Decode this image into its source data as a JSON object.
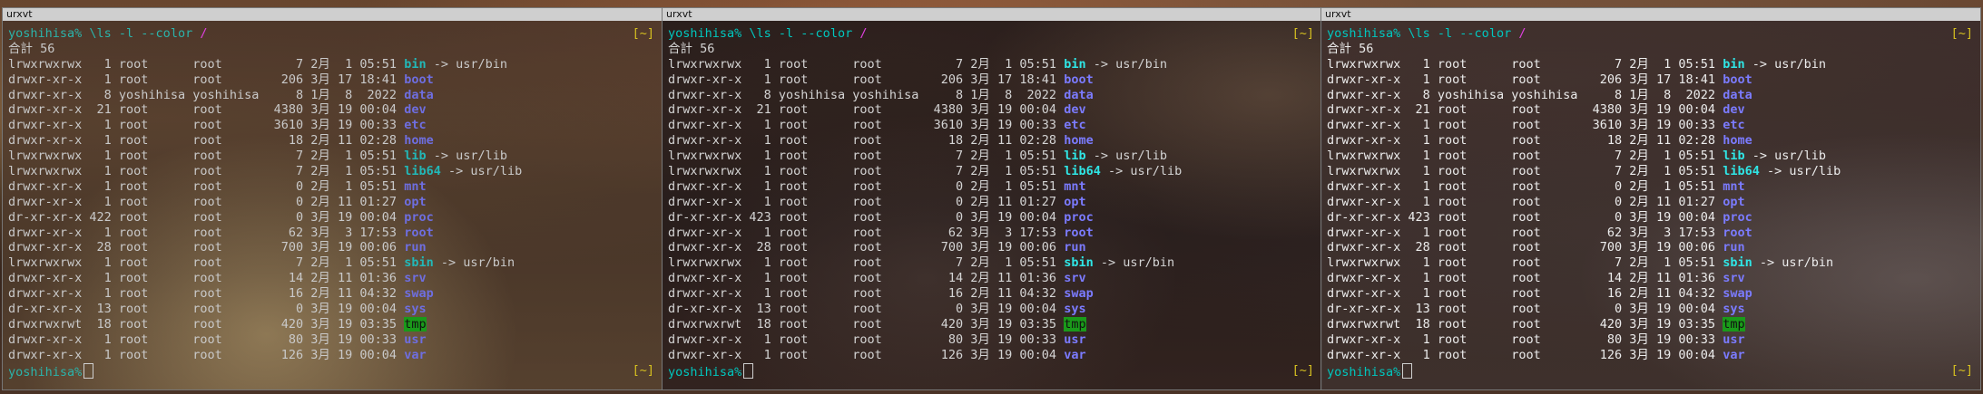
{
  "windows": [
    {
      "title": "urxvt",
      "prompt": {
        "user_host": "yoshihisa%",
        "command": " \\ls -l --color ",
        "cwd_glyph": "/",
        "cwd_tag": "[~]"
      },
      "total": "合計 56",
      "rows": [
        {
          "perm": "lrwxrwxrwx",
          "links": "1",
          "owner": "root",
          "group": "root",
          "size": "7",
          "month": "2月",
          "day": "1",
          "time": "05:51",
          "name": "bin",
          "kind": "link",
          "target": "usr/bin"
        },
        {
          "perm": "drwxr-xr-x",
          "links": "1",
          "owner": "root",
          "group": "root",
          "size": "206",
          "month": "3月",
          "day": "17",
          "time": "18:41",
          "name": "boot",
          "kind": "dir",
          "target": ""
        },
        {
          "perm": "drwxr-xr-x",
          "links": "8",
          "owner": "yoshihisa",
          "group": "yoshihisa",
          "size": "8",
          "month": "1月",
          "day": "8",
          "time": "2022",
          "name": "data",
          "kind": "dir",
          "target": ""
        },
        {
          "perm": "drwxr-xr-x",
          "links": "21",
          "owner": "root",
          "group": "root",
          "size": "4380",
          "month": "3月",
          "day": "19",
          "time": "00:04",
          "name": "dev",
          "kind": "dir",
          "target": ""
        },
        {
          "perm": "drwxr-xr-x",
          "links": "1",
          "owner": "root",
          "group": "root",
          "size": "3610",
          "month": "3月",
          "day": "19",
          "time": "00:33",
          "name": "etc",
          "kind": "dir",
          "target": ""
        },
        {
          "perm": "drwxr-xr-x",
          "links": "1",
          "owner": "root",
          "group": "root",
          "size": "18",
          "month": "2月",
          "day": "11",
          "time": "02:28",
          "name": "home",
          "kind": "dir",
          "target": ""
        },
        {
          "perm": "lrwxrwxrwx",
          "links": "1",
          "owner": "root",
          "group": "root",
          "size": "7",
          "month": "2月",
          "day": "1",
          "time": "05:51",
          "name": "lib",
          "kind": "link",
          "target": "usr/lib"
        },
        {
          "perm": "lrwxrwxrwx",
          "links": "1",
          "owner": "root",
          "group": "root",
          "size": "7",
          "month": "2月",
          "day": "1",
          "time": "05:51",
          "name": "lib64",
          "kind": "link",
          "target": "usr/lib"
        },
        {
          "perm": "drwxr-xr-x",
          "links": "1",
          "owner": "root",
          "group": "root",
          "size": "0",
          "month": "2月",
          "day": "1",
          "time": "05:51",
          "name": "mnt",
          "kind": "dir",
          "target": ""
        },
        {
          "perm": "drwxr-xr-x",
          "links": "1",
          "owner": "root",
          "group": "root",
          "size": "0",
          "month": "2月",
          "day": "11",
          "time": "01:27",
          "name": "opt",
          "kind": "dir",
          "target": ""
        },
        {
          "perm": "dr-xr-xr-x",
          "links": "422",
          "owner": "root",
          "group": "root",
          "size": "0",
          "month": "3月",
          "day": "19",
          "time": "00:04",
          "name": "proc",
          "kind": "dir",
          "target": ""
        },
        {
          "perm": "drwxr-xr-x",
          "links": "1",
          "owner": "root",
          "group": "root",
          "size": "62",
          "month": "3月",
          "day": "3",
          "time": "17:53",
          "name": "root",
          "kind": "dir",
          "target": ""
        },
        {
          "perm": "drwxr-xr-x",
          "links": "28",
          "owner": "root",
          "group": "root",
          "size": "700",
          "month": "3月",
          "day": "19",
          "time": "00:06",
          "name": "run",
          "kind": "dir",
          "target": ""
        },
        {
          "perm": "lrwxrwxrwx",
          "links": "1",
          "owner": "root",
          "group": "root",
          "size": "7",
          "month": "2月",
          "day": "1",
          "time": "05:51",
          "name": "sbin",
          "kind": "link",
          "target": "usr/bin"
        },
        {
          "perm": "drwxr-xr-x",
          "links": "1",
          "owner": "root",
          "group": "root",
          "size": "14",
          "month": "2月",
          "day": "11",
          "time": "01:36",
          "name": "srv",
          "kind": "dir",
          "target": ""
        },
        {
          "perm": "drwxr-xr-x",
          "links": "1",
          "owner": "root",
          "group": "root",
          "size": "16",
          "month": "2月",
          "day": "11",
          "time": "04:32",
          "name": "swap",
          "kind": "dir",
          "target": ""
        },
        {
          "perm": "dr-xr-xr-x",
          "links": "13",
          "owner": "root",
          "group": "root",
          "size": "0",
          "month": "3月",
          "day": "19",
          "time": "00:04",
          "name": "sys",
          "kind": "dir",
          "target": ""
        },
        {
          "perm": "drwxrwxrwt",
          "links": "18",
          "owner": "root",
          "group": "root",
          "size": "420",
          "month": "3月",
          "day": "19",
          "time": "03:35",
          "name": "tmp",
          "kind": "sticky",
          "target": ""
        },
        {
          "perm": "drwxr-xr-x",
          "links": "1",
          "owner": "root",
          "group": "root",
          "size": "80",
          "month": "3月",
          "day": "19",
          "time": "00:33",
          "name": "usr",
          "kind": "dir",
          "target": ""
        },
        {
          "perm": "drwxr-xr-x",
          "links": "1",
          "owner": "root",
          "group": "root",
          "size": "126",
          "month": "3月",
          "day": "19",
          "time": "00:04",
          "name": "var",
          "kind": "dir",
          "target": ""
        }
      ],
      "end_prompt": "yoshihisa%",
      "end_cwd_tag": "[~]"
    },
    {
      "title": "urxvt",
      "prompt": {
        "user_host": "yoshihisa%",
        "command": " \\ls -l --color ",
        "cwd_glyph": "/",
        "cwd_tag": "[~]"
      },
      "total": "合計 56",
      "rows": [
        {
          "perm": "lrwxrwxrwx",
          "links": "1",
          "owner": "root",
          "group": "root",
          "size": "7",
          "month": "2月",
          "day": "1",
          "time": "05:51",
          "name": "bin",
          "kind": "link",
          "target": "usr/bin"
        },
        {
          "perm": "drwxr-xr-x",
          "links": "1",
          "owner": "root",
          "group": "root",
          "size": "206",
          "month": "3月",
          "day": "17",
          "time": "18:41",
          "name": "boot",
          "kind": "dir",
          "target": ""
        },
        {
          "perm": "drwxr-xr-x",
          "links": "8",
          "owner": "yoshihisa",
          "group": "yoshihisa",
          "size": "8",
          "month": "1月",
          "day": "8",
          "time": "2022",
          "name": "data",
          "kind": "dir",
          "target": ""
        },
        {
          "perm": "drwxr-xr-x",
          "links": "21",
          "owner": "root",
          "group": "root",
          "size": "4380",
          "month": "3月",
          "day": "19",
          "time": "00:04",
          "name": "dev",
          "kind": "dir",
          "target": ""
        },
        {
          "perm": "drwxr-xr-x",
          "links": "1",
          "owner": "root",
          "group": "root",
          "size": "3610",
          "month": "3月",
          "day": "19",
          "time": "00:33",
          "name": "etc",
          "kind": "dir",
          "target": ""
        },
        {
          "perm": "drwxr-xr-x",
          "links": "1",
          "owner": "root",
          "group": "root",
          "size": "18",
          "month": "2月",
          "day": "11",
          "time": "02:28",
          "name": "home",
          "kind": "dir",
          "target": ""
        },
        {
          "perm": "lrwxrwxrwx",
          "links": "1",
          "owner": "root",
          "group": "root",
          "size": "7",
          "month": "2月",
          "day": "1",
          "time": "05:51",
          "name": "lib",
          "kind": "link",
          "target": "usr/lib"
        },
        {
          "perm": "lrwxrwxrwx",
          "links": "1",
          "owner": "root",
          "group": "root",
          "size": "7",
          "month": "2月",
          "day": "1",
          "time": "05:51",
          "name": "lib64",
          "kind": "link",
          "target": "usr/lib"
        },
        {
          "perm": "drwxr-xr-x",
          "links": "1",
          "owner": "root",
          "group": "root",
          "size": "0",
          "month": "2月",
          "day": "1",
          "time": "05:51",
          "name": "mnt",
          "kind": "dir",
          "target": ""
        },
        {
          "perm": "drwxr-xr-x",
          "links": "1",
          "owner": "root",
          "group": "root",
          "size": "0",
          "month": "2月",
          "day": "11",
          "time": "01:27",
          "name": "opt",
          "kind": "dir",
          "target": ""
        },
        {
          "perm": "dr-xr-xr-x",
          "links": "423",
          "owner": "root",
          "group": "root",
          "size": "0",
          "month": "3月",
          "day": "19",
          "time": "00:04",
          "name": "proc",
          "kind": "dir",
          "target": ""
        },
        {
          "perm": "drwxr-xr-x",
          "links": "1",
          "owner": "root",
          "group": "root",
          "size": "62",
          "month": "3月",
          "day": "3",
          "time": "17:53",
          "name": "root",
          "kind": "dir",
          "target": ""
        },
        {
          "perm": "drwxr-xr-x",
          "links": "28",
          "owner": "root",
          "group": "root",
          "size": "700",
          "month": "3月",
          "day": "19",
          "time": "00:06",
          "name": "run",
          "kind": "dir",
          "target": ""
        },
        {
          "perm": "lrwxrwxrwx",
          "links": "1",
          "owner": "root",
          "group": "root",
          "size": "7",
          "month": "2月",
          "day": "1",
          "time": "05:51",
          "name": "sbin",
          "kind": "link",
          "target": "usr/bin"
        },
        {
          "perm": "drwxr-xr-x",
          "links": "1",
          "owner": "root",
          "group": "root",
          "size": "14",
          "month": "2月",
          "day": "11",
          "time": "01:36",
          "name": "srv",
          "kind": "dir",
          "target": ""
        },
        {
          "perm": "drwxr-xr-x",
          "links": "1",
          "owner": "root",
          "group": "root",
          "size": "16",
          "month": "2月",
          "day": "11",
          "time": "04:32",
          "name": "swap",
          "kind": "dir",
          "target": ""
        },
        {
          "perm": "dr-xr-xr-x",
          "links": "13",
          "owner": "root",
          "group": "root",
          "size": "0",
          "month": "3月",
          "day": "19",
          "time": "00:04",
          "name": "sys",
          "kind": "dir",
          "target": ""
        },
        {
          "perm": "drwxrwxrwt",
          "links": "18",
          "owner": "root",
          "group": "root",
          "size": "420",
          "month": "3月",
          "day": "19",
          "time": "03:35",
          "name": "tmp",
          "kind": "sticky",
          "target": ""
        },
        {
          "perm": "drwxr-xr-x",
          "links": "1",
          "owner": "root",
          "group": "root",
          "size": "80",
          "month": "3月",
          "day": "19",
          "time": "00:33",
          "name": "usr",
          "kind": "dir",
          "target": ""
        },
        {
          "perm": "drwxr-xr-x",
          "links": "1",
          "owner": "root",
          "group": "root",
          "size": "126",
          "month": "3月",
          "day": "19",
          "time": "00:04",
          "name": "var",
          "kind": "dir",
          "target": ""
        }
      ],
      "end_prompt": "yoshihisa%",
      "end_cwd_tag": "[~]"
    },
    {
      "title": "urxvt",
      "prompt": {
        "user_host": "yoshihisa%",
        "command": " \\ls -l --color ",
        "cwd_glyph": "/",
        "cwd_tag": "[~]"
      },
      "total": "合計 56",
      "rows": [
        {
          "perm": "lrwxrwxrwx",
          "links": "1",
          "owner": "root",
          "group": "root",
          "size": "7",
          "month": "2月",
          "day": "1",
          "time": "05:51",
          "name": "bin",
          "kind": "link",
          "target": "usr/bin"
        },
        {
          "perm": "drwxr-xr-x",
          "links": "1",
          "owner": "root",
          "group": "root",
          "size": "206",
          "month": "3月",
          "day": "17",
          "time": "18:41",
          "name": "boot",
          "kind": "dir",
          "target": ""
        },
        {
          "perm": "drwxr-xr-x",
          "links": "8",
          "owner": "yoshihisa",
          "group": "yoshihisa",
          "size": "8",
          "month": "1月",
          "day": "8",
          "time": "2022",
          "name": "data",
          "kind": "dir",
          "target": ""
        },
        {
          "perm": "drwxr-xr-x",
          "links": "21",
          "owner": "root",
          "group": "root",
          "size": "4380",
          "month": "3月",
          "day": "19",
          "time": "00:04",
          "name": "dev",
          "kind": "dir",
          "target": ""
        },
        {
          "perm": "drwxr-xr-x",
          "links": "1",
          "owner": "root",
          "group": "root",
          "size": "3610",
          "month": "3月",
          "day": "19",
          "time": "00:33",
          "name": "etc",
          "kind": "dir",
          "target": ""
        },
        {
          "perm": "drwxr-xr-x",
          "links": "1",
          "owner": "root",
          "group": "root",
          "size": "18",
          "month": "2月",
          "day": "11",
          "time": "02:28",
          "name": "home",
          "kind": "dir",
          "target": ""
        },
        {
          "perm": "lrwxrwxrwx",
          "links": "1",
          "owner": "root",
          "group": "root",
          "size": "7",
          "month": "2月",
          "day": "1",
          "time": "05:51",
          "name": "lib",
          "kind": "link",
          "target": "usr/lib"
        },
        {
          "perm": "lrwxrwxrwx",
          "links": "1",
          "owner": "root",
          "group": "root",
          "size": "7",
          "month": "2月",
          "day": "1",
          "time": "05:51",
          "name": "lib64",
          "kind": "link",
          "target": "usr/lib"
        },
        {
          "perm": "drwxr-xr-x",
          "links": "1",
          "owner": "root",
          "group": "root",
          "size": "0",
          "month": "2月",
          "day": "1",
          "time": "05:51",
          "name": "mnt",
          "kind": "dir",
          "target": ""
        },
        {
          "perm": "drwxr-xr-x",
          "links": "1",
          "owner": "root",
          "group": "root",
          "size": "0",
          "month": "2月",
          "day": "11",
          "time": "01:27",
          "name": "opt",
          "kind": "dir",
          "target": ""
        },
        {
          "perm": "dr-xr-xr-x",
          "links": "423",
          "owner": "root",
          "group": "root",
          "size": "0",
          "month": "3月",
          "day": "19",
          "time": "00:04",
          "name": "proc",
          "kind": "dir",
          "target": ""
        },
        {
          "perm": "drwxr-xr-x",
          "links": "1",
          "owner": "root",
          "group": "root",
          "size": "62",
          "month": "3月",
          "day": "3",
          "time": "17:53",
          "name": "root",
          "kind": "dir",
          "target": ""
        },
        {
          "perm": "drwxr-xr-x",
          "links": "28",
          "owner": "root",
          "group": "root",
          "size": "700",
          "month": "3月",
          "day": "19",
          "time": "00:06",
          "name": "run",
          "kind": "dir",
          "target": ""
        },
        {
          "perm": "lrwxrwxrwx",
          "links": "1",
          "owner": "root",
          "group": "root",
          "size": "7",
          "month": "2月",
          "day": "1",
          "time": "05:51",
          "name": "sbin",
          "kind": "link",
          "target": "usr/bin"
        },
        {
          "perm": "drwxr-xr-x",
          "links": "1",
          "owner": "root",
          "group": "root",
          "size": "14",
          "month": "2月",
          "day": "11",
          "time": "01:36",
          "name": "srv",
          "kind": "dir",
          "target": ""
        },
        {
          "perm": "drwxr-xr-x",
          "links": "1",
          "owner": "root",
          "group": "root",
          "size": "16",
          "month": "2月",
          "day": "11",
          "time": "04:32",
          "name": "swap",
          "kind": "dir",
          "target": ""
        },
        {
          "perm": "dr-xr-xr-x",
          "links": "13",
          "owner": "root",
          "group": "root",
          "size": "0",
          "month": "3月",
          "day": "19",
          "time": "00:04",
          "name": "sys",
          "kind": "dir",
          "target": ""
        },
        {
          "perm": "drwxrwxrwt",
          "links": "18",
          "owner": "root",
          "group": "root",
          "size": "420",
          "month": "3月",
          "day": "19",
          "time": "03:35",
          "name": "tmp",
          "kind": "sticky",
          "target": ""
        },
        {
          "perm": "drwxr-xr-x",
          "links": "1",
          "owner": "root",
          "group": "root",
          "size": "80",
          "month": "3月",
          "day": "19",
          "time": "00:33",
          "name": "usr",
          "kind": "dir",
          "target": ""
        },
        {
          "perm": "drwxr-xr-x",
          "links": "1",
          "owner": "root",
          "group": "root",
          "size": "126",
          "month": "3月",
          "day": "19",
          "time": "00:04",
          "name": "var",
          "kind": "dir",
          "target": ""
        }
      ],
      "end_prompt": "yoshihisa%",
      "end_cwd_tag": "[~]"
    }
  ],
  "colors": {
    "prompt": "#00c7bf",
    "cwd_glyph": "#e040e0",
    "cwd_tag": "#d6c020",
    "directory": "#7b7bff",
    "symlink": "#2fe6e6",
    "sticky_bg": "#1a9a1a",
    "titlebar": "#cfcfcf"
  }
}
